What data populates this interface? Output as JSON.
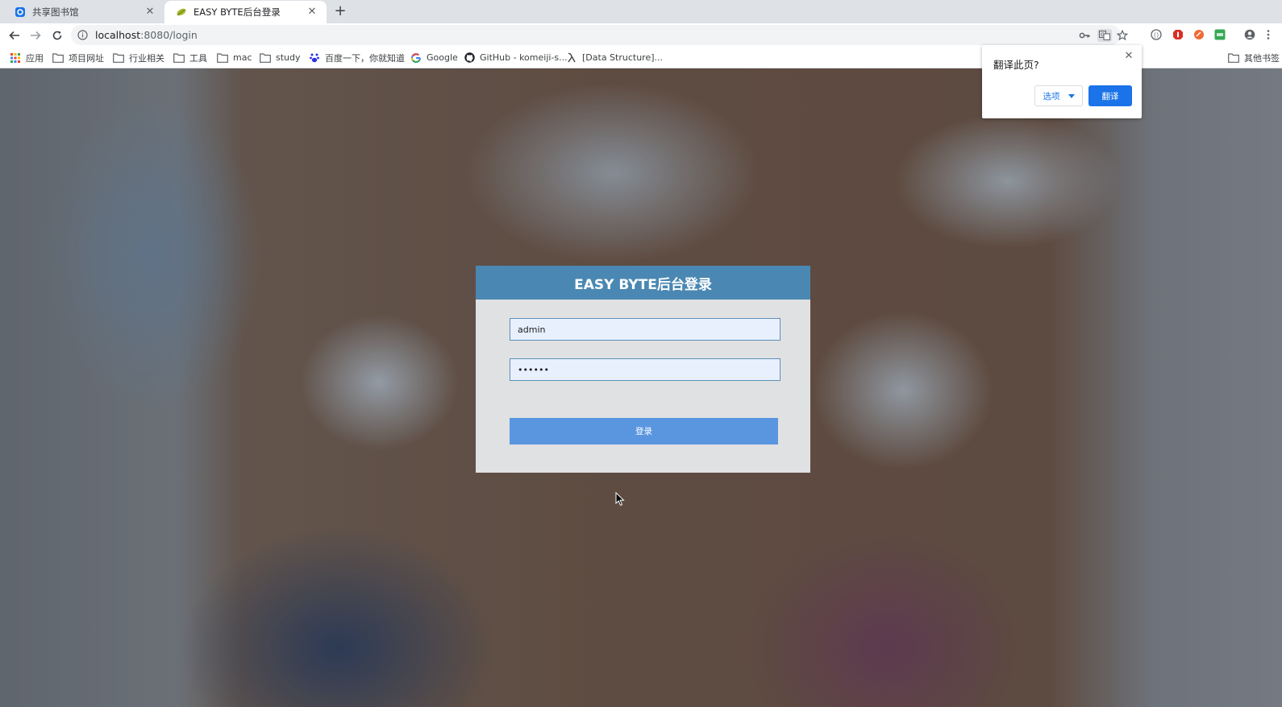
{
  "tabs": [
    {
      "title": "共享图书馆",
      "active": false
    },
    {
      "title": "EASY BYTE后台登录",
      "active": true
    }
  ],
  "toolbar": {
    "url_host": "localhost",
    "url_rest": ":8080/login"
  },
  "bookmarks": [
    {
      "label": "应用",
      "icon": "apps-grid-icon"
    },
    {
      "label": "项目网址",
      "icon": "folder-icon"
    },
    {
      "label": "行业相关",
      "icon": "folder-icon"
    },
    {
      "label": "工具",
      "icon": "folder-icon"
    },
    {
      "label": "mac",
      "icon": "folder-icon"
    },
    {
      "label": "study",
      "icon": "folder-icon"
    },
    {
      "label": "百度一下，你就知道",
      "icon": "baidu-paw-icon"
    },
    {
      "label": "Google",
      "icon": "google-icon"
    },
    {
      "label": "GitHub - komeiji-s...",
      "icon": "github-icon"
    },
    {
      "label": "[Data Structure]...",
      "icon": "lambda-icon"
    },
    {
      "label": "其他书签",
      "icon": "folder-icon"
    }
  ],
  "translate_popup": {
    "title": "翻译此页?",
    "options_label": "选项",
    "translate_label": "翻译"
  },
  "login": {
    "title": "EASY BYTE后台登录",
    "username_value": "admin",
    "password_value": "••••••",
    "submit_label": "登录"
  },
  "colors": {
    "header_blue": "#4a88b3",
    "button_blue": "#5a96e0",
    "chrome_blue": "#1a73e8"
  }
}
